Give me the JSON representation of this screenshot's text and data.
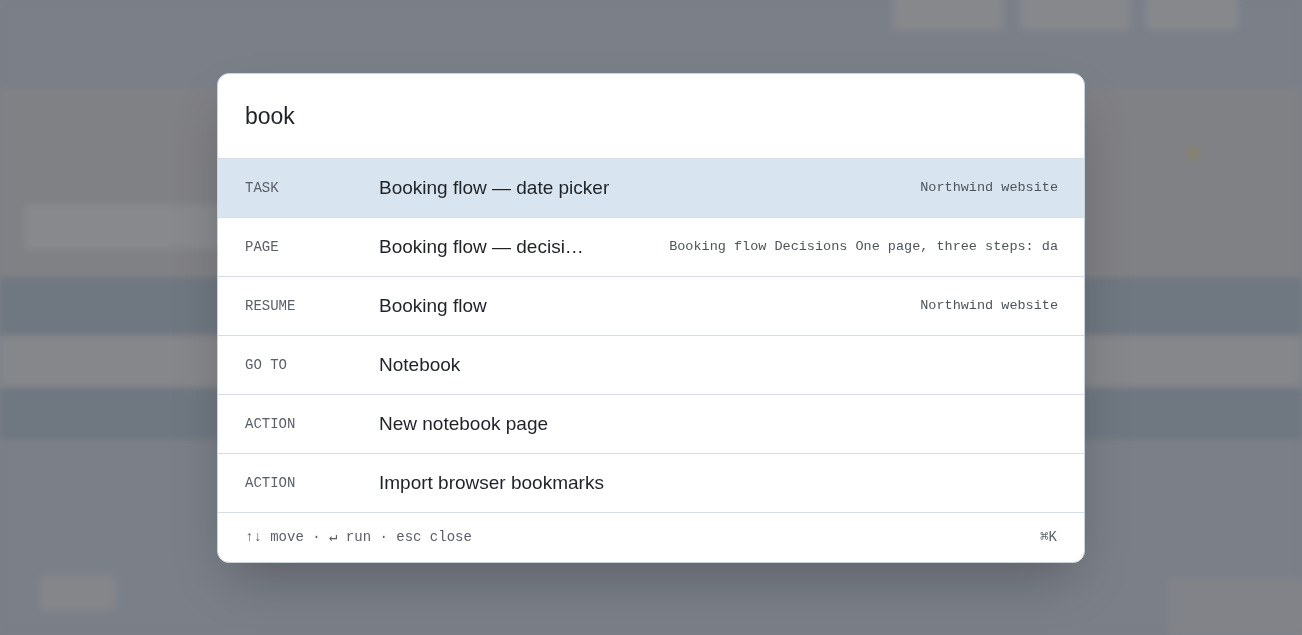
{
  "palette": {
    "query": "book",
    "results": [
      {
        "kind": "TASK",
        "title": "Booking flow — date picker",
        "meta": "Northwind website",
        "selected": true
      },
      {
        "kind": "PAGE",
        "title": "Booking flow — decisi…",
        "meta": "Booking flow Decisions One page, three steps: da",
        "selected": false
      },
      {
        "kind": "RESUME",
        "title": "Booking flow",
        "meta": "Northwind website",
        "selected": false
      },
      {
        "kind": "GO TO",
        "title": "Notebook",
        "selected": false
      },
      {
        "kind": "ACTION",
        "title": "New notebook page",
        "selected": false
      },
      {
        "kind": "ACTION",
        "title": "Import browser bookmarks",
        "selected": false
      }
    ],
    "footer_hint": "↑↓ move · ↵ run · esc close",
    "shortcut": "⌘K"
  }
}
